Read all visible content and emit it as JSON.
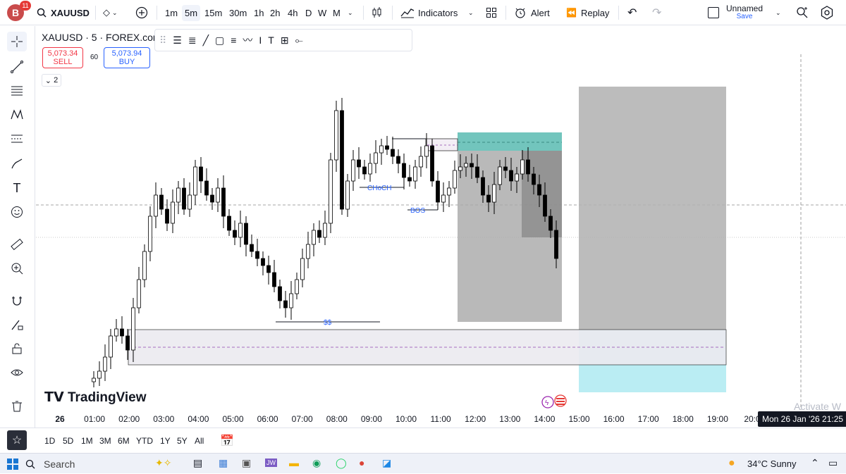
{
  "topbar": {
    "avatar_letter": "B",
    "notifications": "11",
    "symbol": "XAUUSD",
    "timeframes": [
      "1m",
      "5m",
      "15m",
      "30m",
      "1h",
      "2h",
      "4h",
      "D",
      "W",
      "M"
    ],
    "active_timeframe": "5m",
    "indicators_label": "Indicators",
    "alert_label": "Alert",
    "replay_label": "Replay",
    "layout_name": "Unnamed",
    "save_label": "Save"
  },
  "chart": {
    "title": "XAUUSD · 5 · FOREX.com",
    "sell_price": "5,073.34",
    "sell_label": "SELL",
    "spread": "60",
    "buy_price": "5,073.94",
    "buy_label": "BUY",
    "collapsed_count": "2",
    "choch_label": "CHoCH",
    "bos_label": "BOS",
    "ss_label": "$$",
    "brand": "TradingView",
    "activate_text": "Activate W"
  },
  "chart_data": {
    "type": "candlestick",
    "x_labels": [
      "26",
      "01:00",
      "02:00",
      "03:00",
      "04:00",
      "05:00",
      "06:00",
      "07:00",
      "08:00",
      "09:00",
      "10:00",
      "11:00",
      "12:00",
      "13:00",
      "14:00",
      "15:00",
      "16:00",
      "17:00",
      "18:00",
      "19:00",
      "20:0"
    ],
    "crosshair_date": "Mon 26 Jan '26   21:25",
    "annotations": [
      "CHoCH",
      "BOS",
      "$$"
    ],
    "colors": {
      "up": "#ffffff",
      "down": "#000000",
      "zone_teal": "#26a69a",
      "zone_grey": "#9e9e9e",
      "zone_cyan": "#80deea",
      "label_blue": "#2962ff"
    }
  },
  "bottombar": {
    "ranges": [
      "1D",
      "5D",
      "1M",
      "3M",
      "6M",
      "YTD",
      "1Y",
      "5Y",
      "All"
    ]
  },
  "taskbar": {
    "search_label": "Search",
    "weather": "34°C  Sunny"
  }
}
